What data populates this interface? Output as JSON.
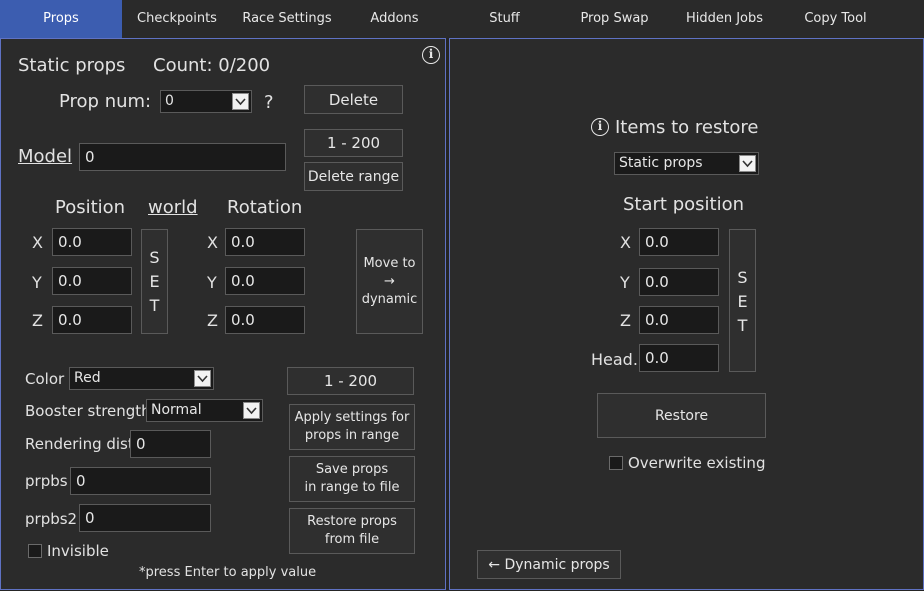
{
  "tabs": [
    {
      "label": "Props",
      "active": true
    },
    {
      "label": "Checkpoints"
    },
    {
      "label": "Race Settings"
    },
    {
      "label": "Addons"
    },
    {
      "label": "Stuff"
    },
    {
      "label": "Prop Swap"
    },
    {
      "label": "Hidden Jobs"
    },
    {
      "label": "Copy Tool"
    }
  ],
  "left": {
    "title": "Static props",
    "count": "Count: 0/200",
    "prop_num_label": "Prop num:",
    "prop_num_value": "0",
    "question": "?",
    "delete_label": "Delete",
    "range_top": "1 - 200",
    "delete_range_label": "Delete range",
    "model_label": "Model",
    "model_value": "0",
    "position_label": "Position",
    "world_label": "world",
    "rotation_label": "Rotation",
    "pos": {
      "x": "0.0",
      "y": "0.0",
      "z": "0.0"
    },
    "rot": {
      "x": "0.0",
      "y": "0.0",
      "z": "0.0"
    },
    "axis": {
      "x": "X",
      "y": "Y",
      "z": "Z"
    },
    "set_letters": [
      "S",
      "E",
      "T"
    ],
    "move_label_1": "Move to",
    "move_arrow": "→",
    "move_label_2": "dynamic",
    "color_label": "Color",
    "color_value": "Red",
    "booster_label": "Booster strength",
    "booster_value": "Normal",
    "render_label": "Rendering dist",
    "render_value": "0",
    "prpbs_label": "prpbs",
    "prpbs_value": "0",
    "prpbs2_label": "prpbs2",
    "prpbs2_value": "0",
    "invisible_label": "Invisible",
    "range_bottom": "1 - 200",
    "apply_1": "Apply settings for",
    "apply_2": "props in range",
    "save_1": "Save props",
    "save_2": "in range to file",
    "restore_1": "Restore props",
    "restore_2": "from file",
    "hint": "*press Enter to apply value"
  },
  "right": {
    "title": "Items to restore",
    "items_select": "Static props",
    "start_label": "Start position",
    "axis": {
      "x": "X",
      "y": "Y",
      "z": "Z",
      "head": "Head."
    },
    "pos": {
      "x": "0.0",
      "y": "0.0",
      "z": "0.0",
      "head": "0.0"
    },
    "set_letters": [
      "S",
      "E",
      "T"
    ],
    "restore_label": "Restore",
    "overwrite_label": "Overwrite existing",
    "dynamic_label": "← Dynamic props"
  },
  "colors": {
    "accent": "#3c5db0",
    "panel_border": "#5f72c4"
  }
}
